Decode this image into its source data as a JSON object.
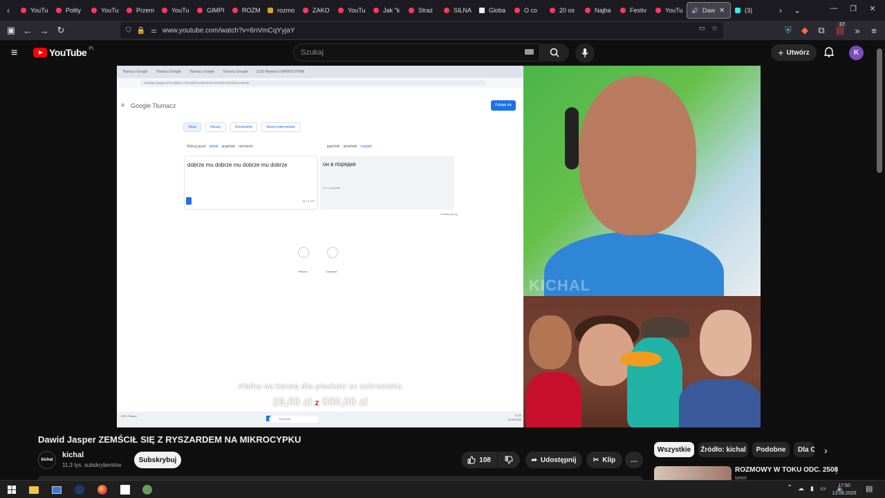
{
  "browser": {
    "tabs": [
      {
        "label": "YouTu",
        "icon": "youtube-icon"
      },
      {
        "label": "Polity",
        "icon": "youtube-icon"
      },
      {
        "label": "YouTu",
        "icon": "youtube-icon"
      },
      {
        "label": "Przem",
        "icon": "youtube-icon"
      },
      {
        "label": "YouTu",
        "icon": "youtube-icon"
      },
      {
        "label": "GIMPI",
        "icon": "youtube-icon"
      },
      {
        "label": "ROZM",
        "icon": "youtube-icon"
      },
      {
        "label": "rozmo",
        "icon": "jp-icon"
      },
      {
        "label": "ZAKO",
        "icon": "youtube-icon"
      },
      {
        "label": "YouTu",
        "icon": "youtube-icon"
      },
      {
        "label": "Jak \"k",
        "icon": "youtube-icon"
      },
      {
        "label": "Straż",
        "icon": "youtube-icon"
      },
      {
        "label": "SILNA",
        "icon": "youtube-icon"
      },
      {
        "label": "Globa",
        "icon": "x-icon"
      },
      {
        "label": "O co",
        "icon": "youtube-icon"
      },
      {
        "label": "20 os",
        "icon": "youtube-icon"
      },
      {
        "label": "Najba",
        "icon": "youtube-icon"
      },
      {
        "label": "Festiv",
        "icon": "youtube-icon"
      },
      {
        "label": "YouTu",
        "icon": "youtube-icon"
      }
    ],
    "active_tab": "Daw",
    "tiktok_tab": "(3)",
    "url": "www.youtube.com/watch?v=6nVmCqYyjaY",
    "extension_badge": "17"
  },
  "youtube": {
    "logo_text": "YouTube",
    "region": "PL",
    "search_placeholder": "Szukaj",
    "create_label": "Utwórz",
    "avatar_letter": "K"
  },
  "screen_content": {
    "tabs": [
      "Tłumacz Google",
      "Tłumacz Google",
      "Tłumacz Google",
      "Tłumacz Google",
      "(118) Wywiad z MIKROCYPEM"
    ],
    "address": "translate.google.pl/?hl=pl&tab=TT&sl=pl&tl=ru&text=dobrze%20mu%20&op=translate",
    "brand": "Google Tłumacz",
    "login": "Zaloguj się",
    "modes": [
      "Tekst",
      "Obrazy",
      "Dokumenty",
      "Strony internetowe"
    ],
    "source_langs": [
      "Wykryj język",
      "polski",
      "angielski",
      "niemiecki"
    ],
    "target_langs": [
      "japoński",
      "ukraiński",
      "rosyjski"
    ],
    "source_text": "dobrze mu dobrze mu dobrze mu dobrze",
    "translation": "он в порядке",
    "transliteration": "on v poryadke",
    "char_count": "36 / 5 000",
    "feedback": "Prześlij opinię",
    "history_label": "Historia",
    "saved_label": "Zapisane",
    "caption_line1": "#fatka na karmę dla piesków ze schroniska",
    "caption_amount": "29,00 zł",
    "caption_of": "z",
    "caption_goal": "500,00 zł",
    "taskbar_search": "Wyszukaj",
    "weather": "25°C Pochm.",
    "time": "17:20",
    "date": "13.08.2025"
  },
  "webcam": {
    "watermark": "KICHAL"
  },
  "video": {
    "title": "Dawid Jasper ZEMŚCIŁ SIĘ Z RYSZARDEM NA MIKROCYPKU",
    "channel_avatar": "kichal",
    "channel_name": "kichal",
    "subscribers": "11,3 tys. subskrybentów",
    "subscribe_label": "Subskrybuj",
    "likes": "108",
    "share_label": "Udostępnij",
    "clip_label": "Klip",
    "more_label": "…"
  },
  "chips": [
    "Wszystkie",
    "Źródło: kichal",
    "Podobne",
    "Dla Ci"
  ],
  "recommendation": {
    "title": "ROZMOWY W TOKU ODC. 2508",
    "subtitle": "tymol"
  },
  "system": {
    "time": "17:50",
    "date": "13.08.2025"
  }
}
